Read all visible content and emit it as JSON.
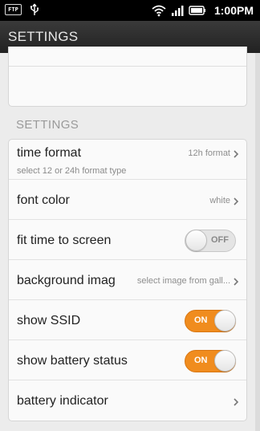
{
  "status_bar": {
    "ftp_label": "FTP",
    "time": "1:00PM",
    "icons": [
      "ftp-icon",
      "usb-icon",
      "wifi-icon",
      "signal-icon",
      "battery-icon"
    ]
  },
  "header": {
    "title": "SETTINGS"
  },
  "section": {
    "title": "SETTINGS"
  },
  "settings": [
    {
      "title": "time format",
      "subtitle": "select 12 or 24h format type",
      "value": "12h format",
      "control": "chevron"
    },
    {
      "title": "font color",
      "value": "white",
      "control": "chevron"
    },
    {
      "title": "fit time to screen",
      "control": "toggle",
      "state": "OFF"
    },
    {
      "title": "background image",
      "value": "select image from gall...",
      "control": "chevron"
    },
    {
      "title": "show SSID",
      "control": "toggle",
      "state": "ON"
    },
    {
      "title": "show battery status",
      "control": "toggle",
      "state": "ON"
    },
    {
      "title": "battery indicator",
      "control": "chevron"
    }
  ],
  "colors": {
    "accent": "#f08c1e",
    "header_bg": "#222222",
    "page_bg": "#ececec"
  }
}
